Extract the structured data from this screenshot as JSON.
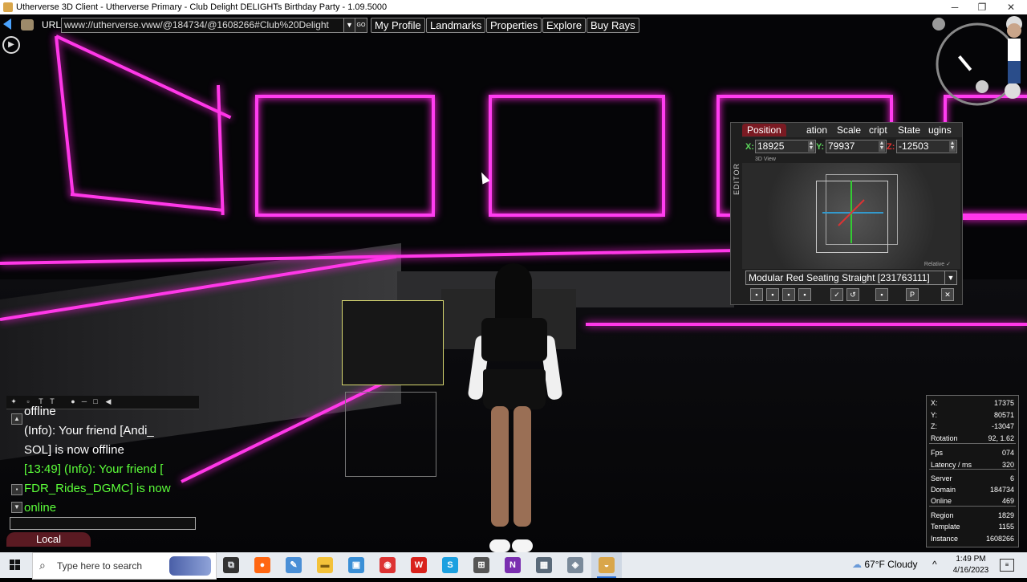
{
  "window": {
    "title": "Utherverse 3D Client - Utherverse Primary - Club Delight DELIGHTs Birthday Party - 1.09.5000",
    "minimize": "─",
    "maximize": "❐",
    "close": "✕"
  },
  "toolbar": {
    "url_label": "URL",
    "url_value": "www://utherverse.vww/@184734/@1608266#Club%20Delight",
    "nav_buttons": [
      "My Profile",
      "Landmarks",
      "Properties",
      "Explore",
      "Buy Rays"
    ]
  },
  "editor": {
    "side_label": "EDITOR",
    "tabs": [
      "Position",
      "ation",
      "Scale",
      "cript",
      "State",
      "ugins"
    ],
    "x_label": "X:",
    "y_label": "Y:",
    "z_label": "Z:",
    "x_value": "18925",
    "y_value": "79937",
    "z_value": "-12503",
    "view_label": "3D View",
    "relative_label": "Relative ✓",
    "object_name": "Modular Red Seating Straight [231763111]"
  },
  "chat": {
    "lines": [
      {
        "text": "offline",
        "color": "#ffffff"
      },
      {
        "text": "(Info): Your friend [Andi_",
        "color": "#ffffff"
      },
      {
        "text": "SOL] is now offline",
        "color": "#ffffff"
      },
      {
        "text": "[13:49] (Info): Your friend [",
        "color": "#5cff3a"
      },
      {
        "text": "FDR_Rides_DGMC] is now",
        "color": "#5cff3a"
      },
      {
        "text": "online",
        "color": "#5cff3a"
      }
    ],
    "tab": "Local"
  },
  "stats": {
    "rows": [
      {
        "key": "X:",
        "value": "17375"
      },
      {
        "key": "Y:",
        "value": "80571"
      },
      {
        "key": "Z:",
        "value": "-13047"
      },
      {
        "key": "Rotation",
        "value": "92, 1.62"
      },
      {
        "key": "Fps",
        "value": "074"
      },
      {
        "key": "Latency / ms",
        "value": "320"
      },
      {
        "key": "Server",
        "value": "6"
      },
      {
        "key": "Domain",
        "value": "184734"
      },
      {
        "key": "Online",
        "value": "469"
      },
      {
        "key": "Region",
        "value": "1829"
      },
      {
        "key": "Template",
        "value": "1155"
      },
      {
        "key": "Instance",
        "value": "1608266"
      }
    ]
  },
  "taskbar": {
    "search_placeholder": "Type here to search",
    "weather": "67°F  Cloudy",
    "time": "1:49 PM",
    "date": "4/16/2023",
    "icons": [
      "task-view-icon",
      "firefox-icon",
      "paint-icon",
      "file-explorer-icon",
      "photos-icon",
      "chrome-icon",
      "wps-icon",
      "skype-icon",
      "games-icon",
      "onenote-icon",
      "calculator-icon",
      "security-icon",
      "utherverse-icon"
    ]
  },
  "colors": {
    "neon": "#ff3df0",
    "chat_green": "#5cff3a",
    "tab_red": "#7a1a22"
  }
}
